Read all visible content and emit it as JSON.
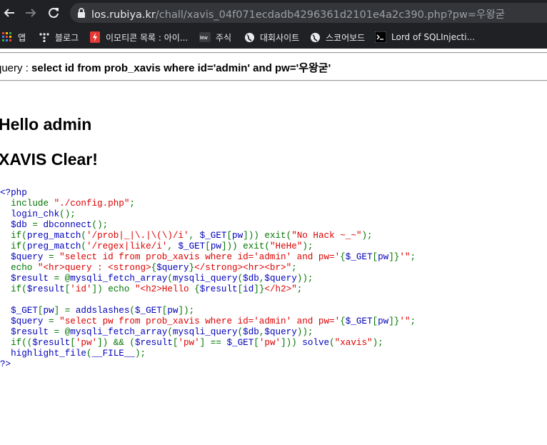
{
  "browser": {
    "url_host": "los.rubiya.kr",
    "url_path": "/chall/xavis_04f071ecdadb4296361d2101e4a2c390.php?pw=우왕굳",
    "bookmarks": [
      {
        "label": "앱",
        "icon": "apps-grid-icon"
      },
      {
        "label": "블로그",
        "icon": "tistory-icon"
      },
      {
        "label": "이모티콘 목록 : 아이...",
        "icon": "bookmark-red-icon"
      },
      {
        "label": "주식",
        "icon": "investing-icon"
      },
      {
        "label": "대회사이트",
        "icon": "globe-icon"
      },
      {
        "label": "스코어보드",
        "icon": "globe-icon"
      },
      {
        "label": "Lord of SQLInjecti...",
        "icon": "terminal-icon"
      }
    ]
  },
  "page": {
    "query_prefix": "query : ",
    "query_value": "select id from prob_xavis where id='admin' and pw='우왕굳'",
    "hello": "Hello admin",
    "clear": "XAVIS Clear!"
  },
  "code": {
    "open_tag": "<?php",
    "close_tag": "?>",
    "colors": {
      "default": "#0000BB",
      "keyword": "#007700",
      "string": "#DD0000"
    }
  }
}
